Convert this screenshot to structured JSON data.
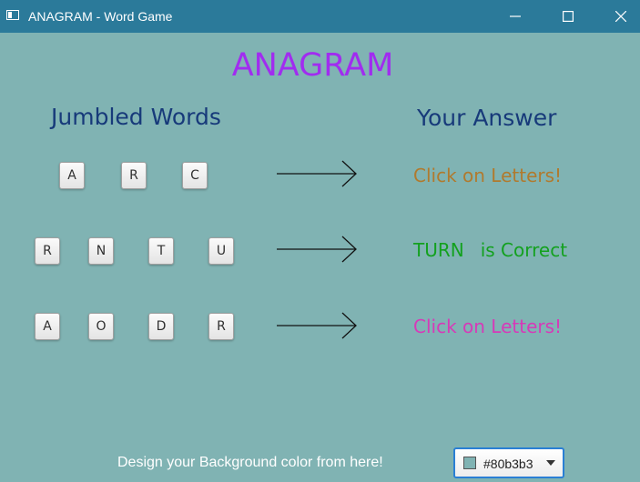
{
  "window": {
    "title": "ANAGRAM - Word Game"
  },
  "app": {
    "title": "ANAGRAM",
    "left_heading": "Jumbled Words",
    "right_heading": "Your Answer"
  },
  "rows": [
    {
      "letters": [
        "A",
        "R",
        "C"
      ],
      "answer": "Click on Letters!"
    },
    {
      "letters": [
        "R",
        "N",
        "T",
        "U"
      ],
      "answer_word": "TURN",
      "answer_status": "is Correct"
    },
    {
      "letters": [
        "A",
        "O",
        "D",
        "R"
      ],
      "answer": "Click on Letters!"
    }
  ],
  "footer": {
    "label": "Design your Background color from here!",
    "color_value": "#80b3b3"
  },
  "colors": {
    "background": "#80b3b3",
    "titlebar": "#2b7a9a",
    "title_text": "#a12cf0",
    "headings": "#173a7a",
    "row1_answer": "#b07a2e",
    "row2_answer": "#13a11f",
    "row3_answer": "#d63ab8"
  },
  "icons": {
    "window_app": "window-icon",
    "minimize": "minimize-icon",
    "maximize": "maximize-icon",
    "close": "close-icon",
    "arrow": "right-arrow-icon",
    "dropdown": "chevron-down-icon"
  }
}
